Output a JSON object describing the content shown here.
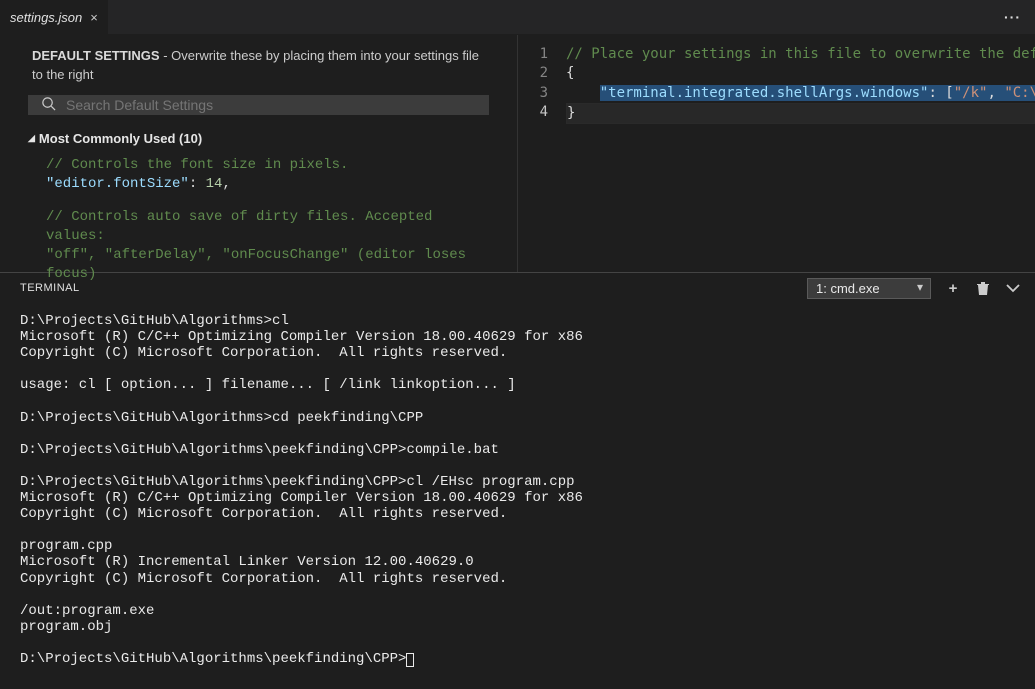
{
  "tabs": {
    "active": "settings.json"
  },
  "left": {
    "header_bold": "DEFAULT SETTINGS",
    "header_rest": " - Overwrite these by placing them into your settings file to the right",
    "search_placeholder": "Search Default Settings",
    "section": "Most Commonly Used (10)",
    "line_cmt1": "// Controls the font size in pixels.",
    "key1": "\"editor.fontSize\"",
    "val1": "14",
    "line_cmt2": "// Controls auto save of dirty files. Accepted values:",
    "line_cmt3": "\"off\", \"afterDelay\", \"onFocusChange\" (editor loses focus)"
  },
  "right": {
    "gutter": [
      "1",
      "2",
      "3",
      "4"
    ],
    "l1_cmt": "// Place your settings in this file to overwrite the defau",
    "l2": "{",
    "l3_key": "\"terminal.integrated.shellArgs.windows\"",
    "l3_mid": ": [",
    "l3_s1": "\"/k\"",
    "l3_c": ", ",
    "l3_s2": "\"C:\\\\P",
    "l4": "}"
  },
  "panel": {
    "title": "TERMINAL",
    "term_select": "1: cmd.exe",
    "terminal_text": "D:\\Projects\\GitHub\\Algorithms>cl\nMicrosoft (R) C/C++ Optimizing Compiler Version 18.00.40629 for x86\nCopyright (C) Microsoft Corporation.  All rights reserved.\n\nusage: cl [ option... ] filename... [ /link linkoption... ]\n\nD:\\Projects\\GitHub\\Algorithms>cd peekfinding\\CPP\n\nD:\\Projects\\GitHub\\Algorithms\\peekfinding\\CPP>compile.bat\n\nD:\\Projects\\GitHub\\Algorithms\\peekfinding\\CPP>cl /EHsc program.cpp\nMicrosoft (R) C/C++ Optimizing Compiler Version 18.00.40629 for x86\nCopyright (C) Microsoft Corporation.  All rights reserved.\n\nprogram.cpp\nMicrosoft (R) Incremental Linker Version 12.00.40629.0\nCopyright (C) Microsoft Corporation.  All rights reserved.\n\n/out:program.exe\nprogram.obj\n\nD:\\Projects\\GitHub\\Algorithms\\peekfinding\\CPP>"
  }
}
